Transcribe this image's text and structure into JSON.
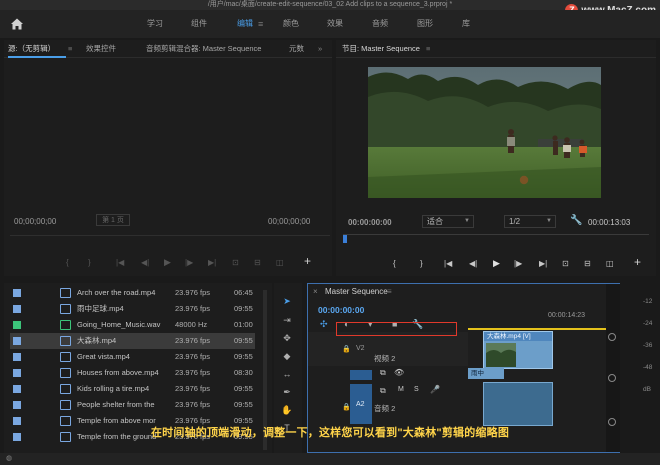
{
  "window": {
    "title": "/用户/mac/桌面/create-edit-sequence/03_02 Add clips to a sequence_3.prproj *"
  },
  "watermark": {
    "logo_letter": "Z",
    "text": "www.MacZ.com"
  },
  "menu": {
    "tabs": [
      "学习",
      "组件",
      "编辑",
      "颜色",
      "效果",
      "音频",
      "图形",
      "库"
    ],
    "active_index": 2
  },
  "source_panel": {
    "tabs": [
      "源:（无剪辑）",
      "效果控件",
      "音频剪辑混合器: Master Sequence",
      "元数"
    ],
    "timecode": "00;00;00;00",
    "timecode_right": "00;00;00;00",
    "page_label": "第 1 页"
  },
  "program_panel": {
    "title": "节目: Master Sequence",
    "timecode": "00:00:00:00",
    "fit_label": "适合",
    "resolution_label": "1/2",
    "duration": "00:00:13:03"
  },
  "project_list": {
    "rows": [
      {
        "name": "Arch over the road.mp4",
        "fps": "23.976 fps",
        "tc": "06:45",
        "color": "#7aa7e0"
      },
      {
        "name": "雨中足球.mp4",
        "fps": "23.976 fps",
        "tc": "09:55",
        "color": "#7aa7e0"
      },
      {
        "name": "Going_Home_Music.wav",
        "fps": "48000 Hz",
        "tc": "01:00",
        "color": "#3cc47a"
      },
      {
        "name": "大森林.mp4",
        "fps": "23.976 fps",
        "tc": "09:55",
        "color": "#7aa7e0"
      },
      {
        "name": "Great vista.mp4",
        "fps": "23.976 fps",
        "tc": "09:55",
        "color": "#7aa7e0"
      },
      {
        "name": "Houses from above.mp4",
        "fps": "23.976 fps",
        "tc": "08:30",
        "color": "#7aa7e0"
      },
      {
        "name": "Kids rolling a tire.mp4",
        "fps": "23.976 fps",
        "tc": "09:55",
        "color": "#7aa7e0"
      },
      {
        "name": "People shelter from the",
        "fps": "23.976 fps",
        "tc": "09:55",
        "color": "#7aa7e0"
      },
      {
        "name": "Temple from above mor",
        "fps": "23.976 fps",
        "tc": "09:55",
        "color": "#7aa7e0"
      },
      {
        "name": "Temple from the ground",
        "fps": "23.976 fps",
        "tc": "09:55",
        "color": "#7aa7e0"
      }
    ],
    "selected_index": 3
  },
  "timeline": {
    "title": "Master Sequence",
    "timecode": "00:00:00:00",
    "ruler_time": "00:00:14:23",
    "v2_label": "V2",
    "v2_name": "视频 2",
    "a2_label": "A2",
    "a2_name": "音频 2",
    "clip_v_name": "大森林.mp4 [V]",
    "clip_tag": "雨中",
    "audio_mute": "M",
    "audio_solo": "S",
    "db_labels": [
      "-12",
      "-24",
      "-36",
      "-48",
      "dB"
    ]
  },
  "caption": "在时间轴的顶端滑动，调整一下，这样您可以看到\"大森林\"剪辑的缩略图"
}
